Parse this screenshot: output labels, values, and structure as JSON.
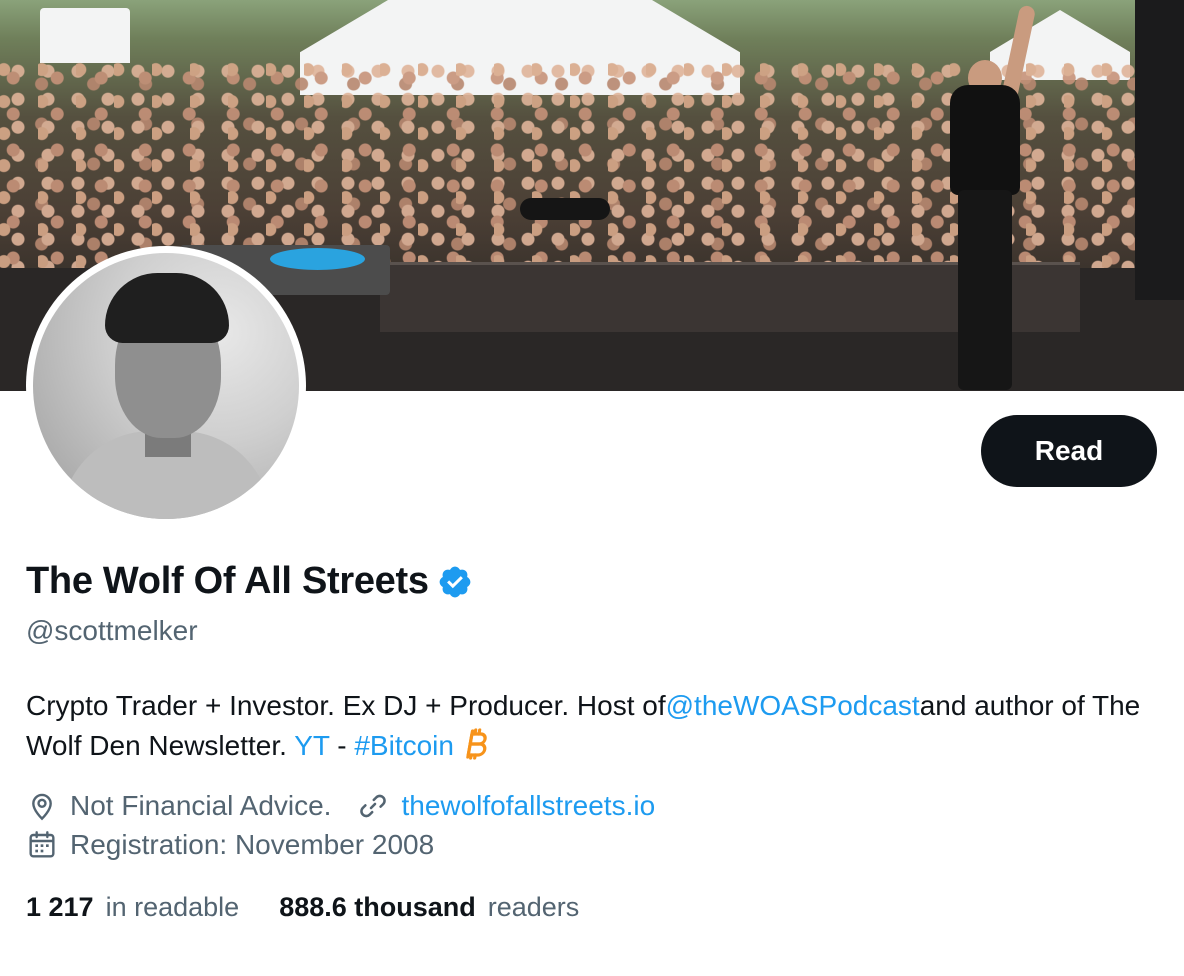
{
  "profile": {
    "display_name": "The Wolf Of All Streets",
    "handle": "@scottmelker",
    "verified": true,
    "accent_color": "#1d9bf0"
  },
  "actions": {
    "read_label": "Read"
  },
  "bio": {
    "text_1": "Crypto Trader + Investor. Ex DJ + Producer. Host of",
    "mention": "@theWOASPodcast",
    "text_2": "and author of The Wolf Den Newsletter. ",
    "yt_link": "YT",
    "separator": " - ",
    "hashtag": "#Bitcoin",
    "emoji_icon": "bitcoin-icon"
  },
  "meta": {
    "location": "Not Financial Advice.",
    "location_icon": "location-pin-icon",
    "website": "thewolfofallstreets.io",
    "website_icon": "link-icon",
    "registration": "Registration: November 2008",
    "registration_icon": "calendar-icon"
  },
  "stats": {
    "following_count": "1 217",
    "following_label": "in readable",
    "followers_count": "888.6 thousand",
    "followers_label": "readers"
  }
}
